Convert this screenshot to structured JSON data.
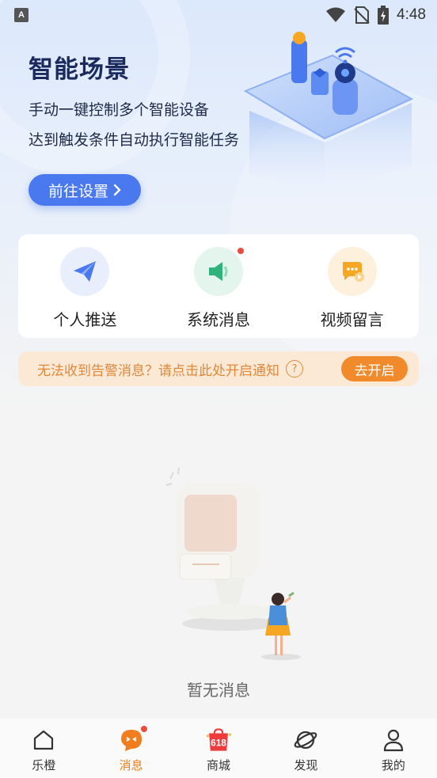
{
  "status_bar": {
    "app_icon_letter": "A",
    "time": "4:48",
    "icons": [
      "wifi-icon",
      "no-sim-icon",
      "battery-charging-icon"
    ]
  },
  "hero": {
    "title": "智能场景",
    "line1": "手动一键控制多个智能设备",
    "line2": "达到触发条件自动执行智能任务",
    "button_label": "前往设置",
    "button_icon": "chevron-right-icon",
    "accent_color": "#4a78ef"
  },
  "categories": [
    {
      "label": "个人推送",
      "icon": "paper-plane-icon",
      "color": "#4a78ef",
      "bg": "#e8eefc",
      "has_dot": false
    },
    {
      "label": "系统消息",
      "icon": "speaker-icon",
      "color": "#2fb37a",
      "bg": "#e3f5ec",
      "has_dot": true
    },
    {
      "label": "视频留言",
      "icon": "chat-bubble-icon",
      "color": "#f5a623",
      "bg": "#fdf0dc",
      "has_dot": false
    }
  ],
  "notice": {
    "text": "无法收到告警消息？请点击此处开启通知",
    "help_glyph": "?",
    "button_label": "去开启",
    "color": "#e0883a"
  },
  "empty_state": {
    "text": "暂无消息"
  },
  "tabbar": {
    "tabs": [
      {
        "label": "乐橙",
        "icon": "home-icon",
        "active": false
      },
      {
        "label": "消息",
        "icon": "message-face-icon",
        "active": true,
        "has_dot": true
      },
      {
        "label": "商城",
        "icon": "shopping-bag-618-icon",
        "active": false,
        "badge_text": "618"
      },
      {
        "label": "发现",
        "icon": "planet-icon",
        "active": false
      },
      {
        "label": "我的",
        "icon": "person-icon",
        "active": false
      }
    ],
    "active_color": "#f07e1e"
  }
}
